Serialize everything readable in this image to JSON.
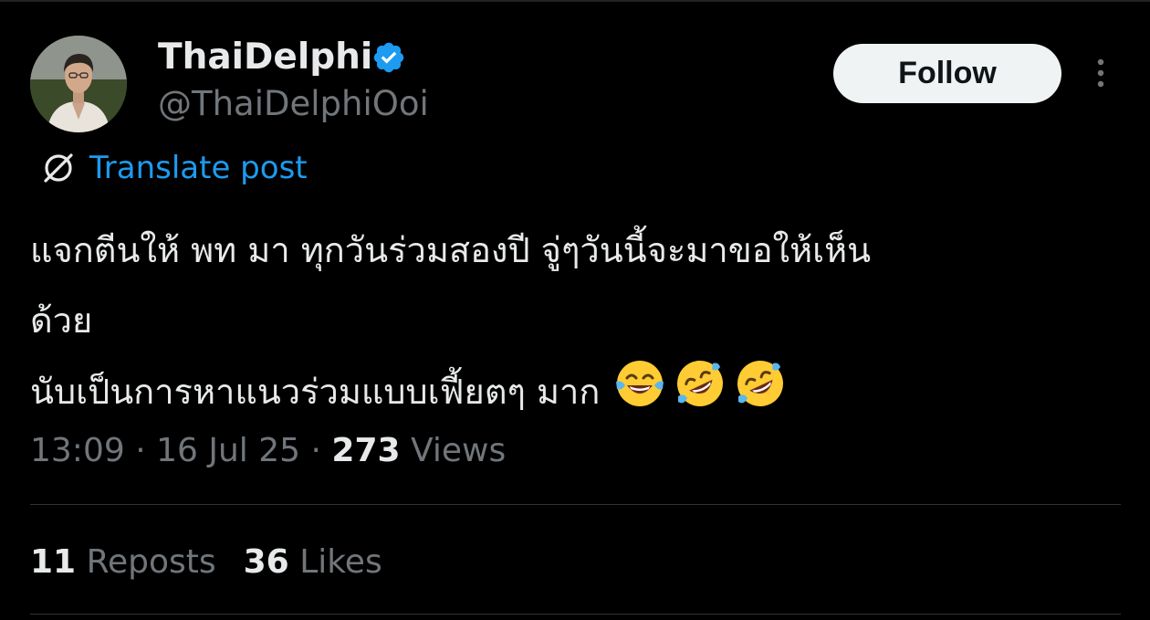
{
  "author": {
    "name": "ThaiDelphi",
    "handle": "@ThaiDelphiOoi",
    "verified": true,
    "avatar_icon": "profile-photo"
  },
  "actions": {
    "follow_label": "Follow",
    "more_icon": "more-vertical-icon"
  },
  "translate": {
    "label": "Translate post",
    "icon": "translate-icon"
  },
  "post": {
    "lines": [
      "แจกตีนให้ พท มา ทุกวันร่วมสองปี จู่ๆวันนี้จะมาขอให้เห็น",
      "ด้วย",
      "นับเป็นการหาแนวร่วมแบบเฟี้ยตๆ มาก"
    ],
    "emojis": [
      "face-with-tears-of-joy",
      "rolling-on-the-floor-laughing",
      "rolling-on-the-floor-laughing"
    ]
  },
  "meta": {
    "time": "13:09",
    "separator": "·",
    "date": "16 Jul 25",
    "views_count": "273",
    "views_label": "Views"
  },
  "stats": {
    "reposts_count": "11",
    "reposts_label": "Reposts",
    "likes_count": "36",
    "likes_label": "Likes"
  },
  "colors": {
    "background": "#000000",
    "text": "#e7e9ea",
    "secondary": "#71767b",
    "link": "#1d9bf0",
    "verified": "#1d9bf0",
    "divider": "#2f3336"
  }
}
